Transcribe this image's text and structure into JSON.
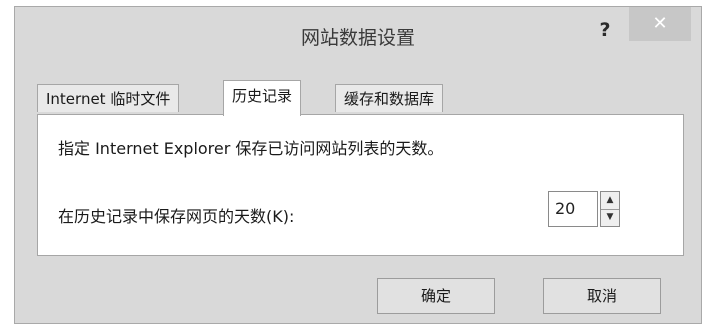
{
  "window": {
    "title": "网站数据设置",
    "help_label": "?",
    "close_label": "✕"
  },
  "tabs": [
    {
      "label": "Internet 临时文件",
      "active": false
    },
    {
      "label": "历史记录",
      "active": true
    },
    {
      "label": "缓存和数据库",
      "active": false
    }
  ],
  "history": {
    "description": "指定 Internet Explorer 保存已访问网站列表的天数。",
    "days_label": "在历史记录中保存网页的天数(K):",
    "days_value": "20",
    "up_arrow": "▲",
    "down_arrow": "▼"
  },
  "buttons": {
    "ok_label": "确定",
    "cancel_label": "取消"
  }
}
